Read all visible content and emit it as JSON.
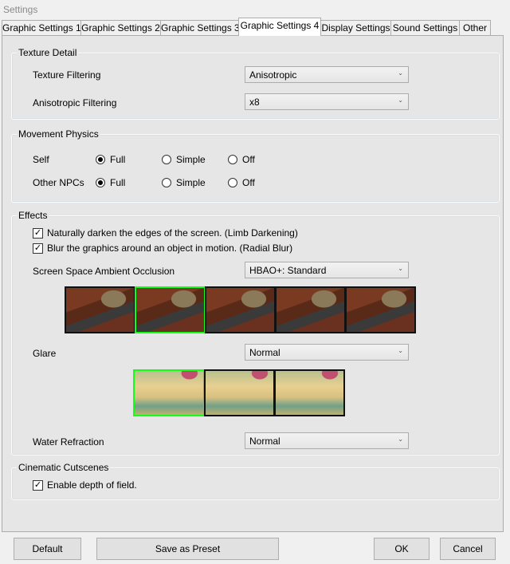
{
  "window": {
    "title": "Settings"
  },
  "tabs": [
    "Graphic Settings 1",
    "Graphic Settings 2",
    "Graphic Settings 3",
    "Graphic Settings 4",
    "Display Settings",
    "Sound Settings",
    "Other"
  ],
  "active_tab": "Graphic Settings 4",
  "texture": {
    "title": "Texture Detail",
    "filtering_label": "Texture Filtering",
    "filtering_value": "Anisotropic",
    "aniso_label": "Anisotropic Filtering",
    "aniso_value": "x8"
  },
  "movement": {
    "title": "Movement Physics",
    "options": [
      "Full",
      "Simple",
      "Off"
    ],
    "self_label": "Self",
    "self_value": "Full",
    "npc_label": "Other NPCs",
    "npc_value": "Full"
  },
  "effects": {
    "title": "Effects",
    "limb": "Naturally darken the edges of the screen. (Limb Darkening)",
    "limb_checked": true,
    "radial": "Blur the graphics around an object in motion. (Radial Blur)",
    "radial_checked": true,
    "ssao_label": "Screen Space Ambient Occlusion",
    "ssao_value": "HBAO+: Standard",
    "ssao_selected_index": 1,
    "glare_label": "Glare",
    "glare_value": "Normal",
    "glare_selected_index": 0,
    "water_label": "Water Refraction",
    "water_value": "Normal"
  },
  "cinematic": {
    "title": "Cinematic Cutscenes",
    "dof": "Enable depth of field.",
    "dof_checked": true
  },
  "buttons": {
    "default": "Default",
    "preset": "Save as Preset",
    "ok": "OK",
    "cancel": "Cancel"
  }
}
